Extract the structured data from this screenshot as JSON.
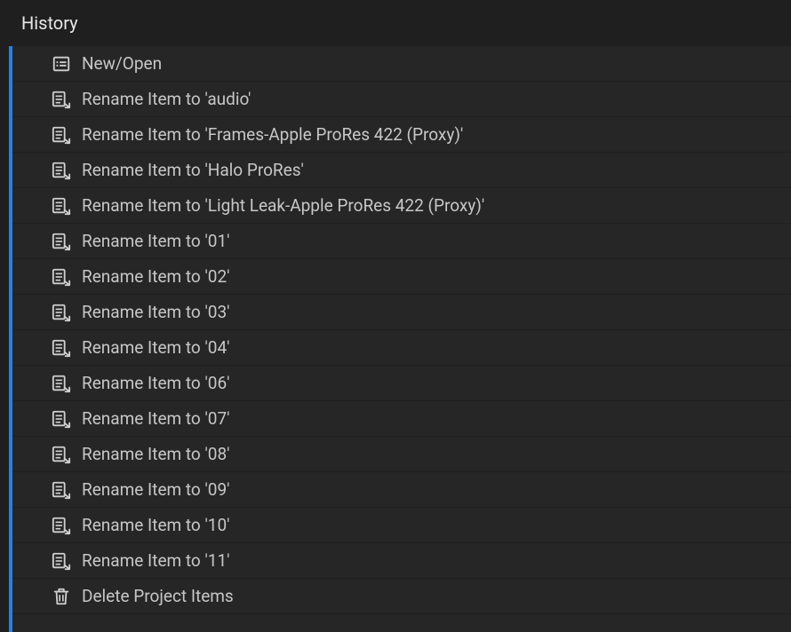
{
  "panel": {
    "title": "History",
    "items": [
      {
        "icon": "new-open-icon",
        "label": "New/Open"
      },
      {
        "icon": "rename-item-icon",
        "label": "Rename Item to 'audio'"
      },
      {
        "icon": "rename-item-icon",
        "label": "Rename Item to 'Frames-Apple ProRes 422 (Proxy)'"
      },
      {
        "icon": "rename-item-icon",
        "label": "Rename Item to 'Halo ProRes'"
      },
      {
        "icon": "rename-item-icon",
        "label": "Rename Item to 'Light Leak-Apple ProRes 422 (Proxy)'"
      },
      {
        "icon": "rename-item-icon",
        "label": "Rename Item to '01'"
      },
      {
        "icon": "rename-item-icon",
        "label": "Rename Item to '02'"
      },
      {
        "icon": "rename-item-icon",
        "label": "Rename Item to '03'"
      },
      {
        "icon": "rename-item-icon",
        "label": "Rename Item to '04'"
      },
      {
        "icon": "rename-item-icon",
        "label": "Rename Item to '06'"
      },
      {
        "icon": "rename-item-icon",
        "label": "Rename Item to '07'"
      },
      {
        "icon": "rename-item-icon",
        "label": "Rename Item to '08'"
      },
      {
        "icon": "rename-item-icon",
        "label": "Rename Item to '09'"
      },
      {
        "icon": "rename-item-icon",
        "label": "Rename Item to '10'"
      },
      {
        "icon": "rename-item-icon",
        "label": "Rename Item to '11'"
      },
      {
        "icon": "delete-item-icon",
        "label": "Delete Project Items"
      }
    ]
  }
}
